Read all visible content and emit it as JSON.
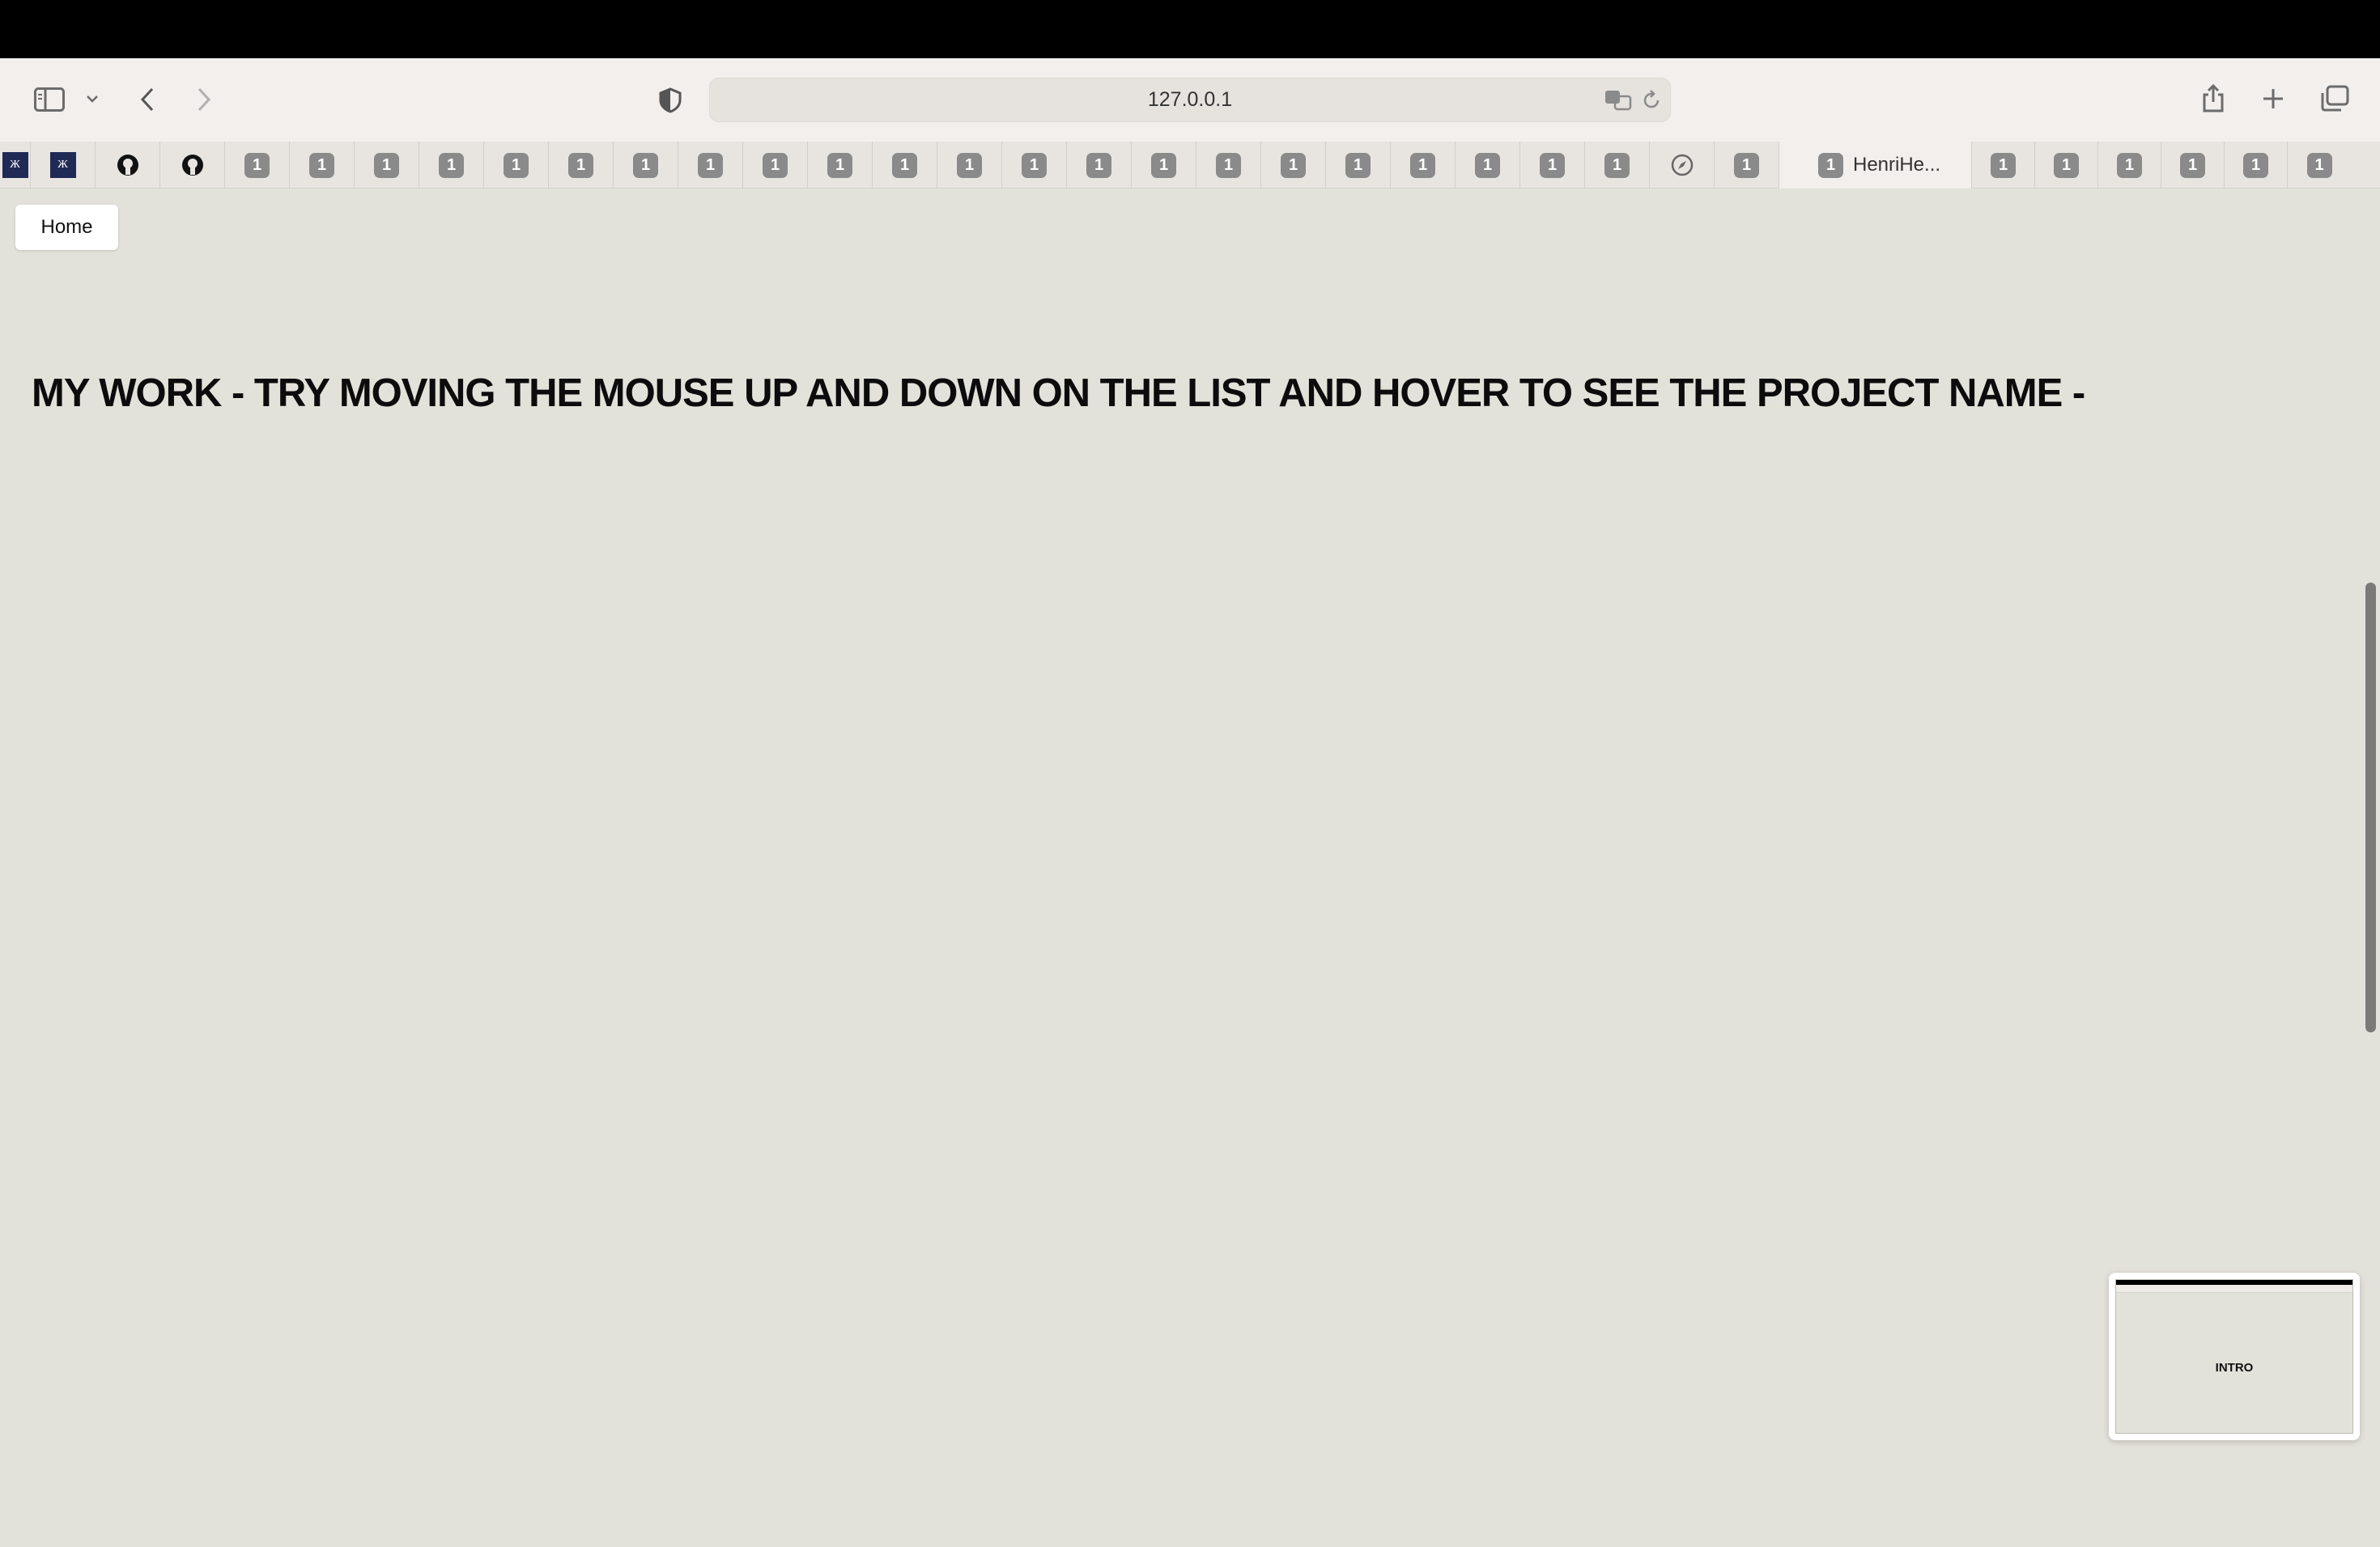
{
  "browser": {
    "address": "127.0.0.1",
    "tabs": {
      "pinned_before": [
        {
          "kind": "logo",
          "label": "Ж"
        },
        {
          "kind": "logo",
          "label": "Ж"
        },
        {
          "kind": "github"
        },
        {
          "kind": "github"
        },
        {
          "kind": "badge",
          "label": "1"
        },
        {
          "kind": "badge",
          "label": "1"
        },
        {
          "kind": "badge",
          "label": "1"
        },
        {
          "kind": "badge",
          "label": "1"
        },
        {
          "kind": "badge",
          "label": "1"
        },
        {
          "kind": "badge",
          "label": "1"
        },
        {
          "kind": "badge",
          "label": "1"
        },
        {
          "kind": "badge",
          "label": "1"
        },
        {
          "kind": "badge",
          "label": "1"
        },
        {
          "kind": "badge",
          "label": "1"
        },
        {
          "kind": "badge",
          "label": "1"
        },
        {
          "kind": "badge",
          "label": "1"
        },
        {
          "kind": "badge",
          "label": "1"
        },
        {
          "kind": "badge",
          "label": "1"
        },
        {
          "kind": "badge",
          "label": "1"
        },
        {
          "kind": "badge",
          "label": "1"
        },
        {
          "kind": "badge",
          "label": "1"
        },
        {
          "kind": "badge",
          "label": "1"
        },
        {
          "kind": "badge",
          "label": "1"
        },
        {
          "kind": "badge",
          "label": "1"
        },
        {
          "kind": "badge",
          "label": "1"
        },
        {
          "kind": "badge",
          "label": "1"
        },
        {
          "kind": "compass"
        },
        {
          "kind": "badge",
          "label": "1"
        }
      ],
      "active": {
        "badge": "1",
        "label": "HenriHe..."
      },
      "after": [
        "1",
        "1",
        "1",
        "1",
        "1",
        "1"
      ]
    }
  },
  "page": {
    "home_button": "Home",
    "headline": "MY WORK - TRY MOVING THE MOUSE UP AND DOWN ON THE LIST AND HOVER TO SEE THE PROJECT NAME -",
    "preview_label": "INTRO"
  },
  "colors": {
    "page_background": "#e3e2da",
    "badge": "#8a8a8a",
    "logo": "#1f2a55"
  }
}
